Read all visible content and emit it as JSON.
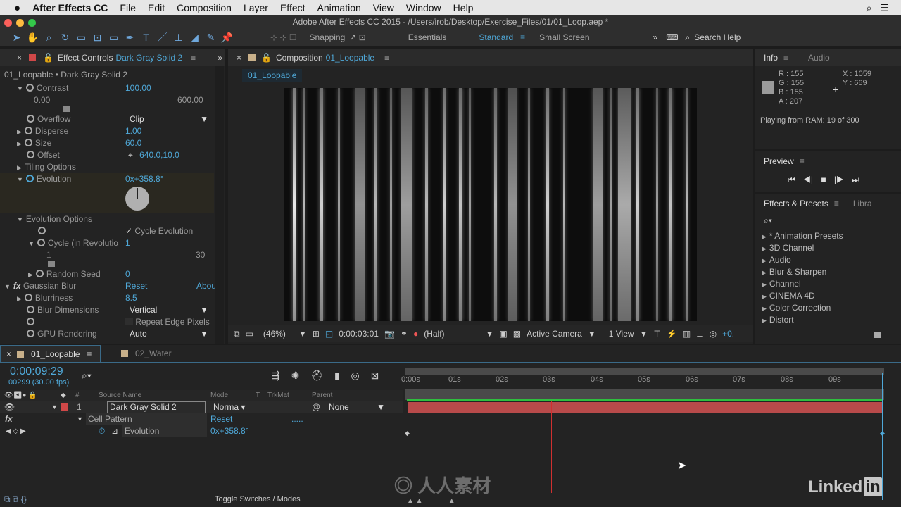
{
  "menubar": {
    "app": "After Effects CC",
    "items": [
      "File",
      "Edit",
      "Composition",
      "Layer",
      "Effect",
      "Animation",
      "View",
      "Window",
      "Help"
    ]
  },
  "window_title": "Adobe After Effects CC 2015 - /Users/irob/Desktop/Exercise_Files/01/01_Loop.aep *",
  "toolbar": {
    "snapping": "Snapping",
    "workspaces": [
      "Essentials",
      "Standard",
      "Small Screen"
    ],
    "active_workspace": "Standard",
    "search_placeholder": "Search Help"
  },
  "effect_controls": {
    "tab_label": "Effect Controls",
    "layer": "Dark Gray Solid 2",
    "breadcrumb": "01_Loopable • Dark Gray Solid 2",
    "contrast": {
      "label": "Contrast",
      "value": "100.00",
      "min": "0.00",
      "max": "600.00"
    },
    "overflow": {
      "label": "Overflow",
      "value": "Clip"
    },
    "disperse": {
      "label": "Disperse",
      "value": "1.00"
    },
    "size": {
      "label": "Size",
      "value": "60.0"
    },
    "offset": {
      "label": "Offset",
      "value": "640.0,10.0"
    },
    "tiling": "Tiling Options",
    "evolution": {
      "label": "Evolution",
      "value": "0x+358.8°"
    },
    "evolution_options": "Evolution Options",
    "cycle_evolution": "Cycle Evolution",
    "cycle": {
      "label": "Cycle (in Revolutio",
      "value": "1",
      "min": "1",
      "max": "30"
    },
    "random_seed": {
      "label": "Random Seed",
      "value": "0"
    },
    "gaussian": {
      "label": "Gaussian Blur",
      "reset": "Reset",
      "about": "Abou"
    },
    "blurriness": {
      "label": "Blurriness",
      "value": "8.5"
    },
    "blur_dimensions": {
      "label": "Blur Dimensions",
      "value": "Vertical"
    },
    "repeat_edge": "Repeat Edge Pixels",
    "gpu": {
      "label": "GPU Rendering",
      "value": "Auto"
    }
  },
  "composition": {
    "tab_label": "Composition",
    "name": "01_Loopable",
    "subtab": "01_Loopable",
    "footer": {
      "zoom": "(46%)",
      "time": "0:00:03:01",
      "resolution": "(Half)",
      "camera": "Active Camera",
      "views": "1 View",
      "exposure": "+0."
    }
  },
  "info": {
    "tab": "Info",
    "tab2": "Audio",
    "r": "R : 155",
    "g": "G : 155",
    "b": "B : 155",
    "a": "A : 207",
    "x": "X : 1059",
    "y": "Y : 669",
    "status": "Playing from RAM: 19 of 300",
    "swatch": "#9b9b9b"
  },
  "preview": {
    "tab": "Preview"
  },
  "effects_presets": {
    "tab": "Effects & Presets",
    "tab2": "Libra",
    "items": [
      "* Animation Presets",
      "3D Channel",
      "Audio",
      "Blur & Sharpen",
      "Channel",
      "CINEMA 4D",
      "Color Correction",
      "Distort"
    ]
  },
  "timeline": {
    "tabs": [
      "01_Loopable",
      "02_Water"
    ],
    "timecode": "0:00:09:29",
    "frames": "00299 (30.00 fps)",
    "columns": {
      "num": "#",
      "source": "Source Name",
      "mode": "Mode",
      "t": "T",
      "trkmat": "TrkMat",
      "parent": "Parent"
    },
    "layer": {
      "index": "1",
      "name": "Dark Gray Solid 2",
      "mode": "Norma",
      "parent": "None",
      "color": "#d04848"
    },
    "effect": {
      "name": "Cell Pattern",
      "reset": "Reset",
      "dots": "....."
    },
    "property": {
      "name": "Evolution",
      "value": "0x+358.8°"
    },
    "ruler": [
      "0:00s",
      "01s",
      "02s",
      "03s",
      "04s",
      "05s",
      "06s",
      "07s",
      "08s",
      "09s"
    ],
    "toggle": "Toggle Switches / Modes"
  },
  "watermark": {
    "brand": "Linked in",
    "site": "人人素材"
  },
  "colors": {
    "accent": "#4fa8d8",
    "layer_bar": "#b84a4a",
    "work_area": "#2fbf3f"
  }
}
